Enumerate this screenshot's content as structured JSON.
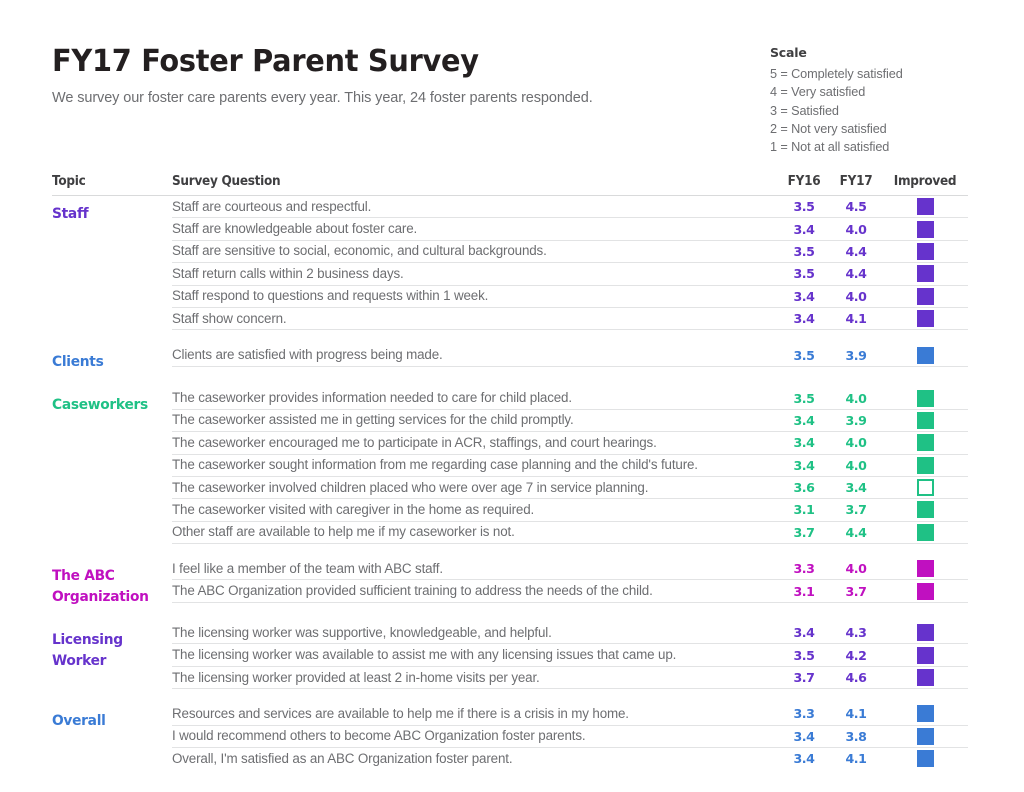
{
  "header": {
    "title": "FY17 Foster Parent Survey",
    "subtitle": "We survey our foster care parents every year. This year, 24 foster parents responded."
  },
  "scale": {
    "title": "Scale",
    "items": [
      "5 = Completely satisfied",
      "4 = Very satisfied",
      "3 = Satisfied",
      "2 = Not very satisfied",
      "1 = Not at all satisfied"
    ]
  },
  "table": {
    "columns": {
      "topic": "Topic",
      "question": "Survey Question",
      "fy16": "FY16",
      "fy17": "FY17",
      "improved": "Improved"
    },
    "colors": {
      "staff": "#6633cc",
      "clients": "#3a7bd5",
      "caseworkers": "#1fc185",
      "abc": "#c010c0",
      "licensing": "#6633cc",
      "overall": "#3a7bd5"
    },
    "sections": [
      {
        "topic": "Staff",
        "color": "#6633cc",
        "rows": [
          {
            "question": "Staff are courteous and respectful.",
            "fy16": "3.5",
            "fy17": "4.5",
            "improved": true
          },
          {
            "question": "Staff are knowledgeable about foster care.",
            "fy16": "3.4",
            "fy17": "4.0",
            "improved": true
          },
          {
            "question": "Staff are sensitive to social, economic, and cultural backgrounds.",
            "fy16": "3.5",
            "fy17": "4.4",
            "improved": true
          },
          {
            "question": "Staff return calls within 2 business days.",
            "fy16": "3.5",
            "fy17": "4.4",
            "improved": true
          },
          {
            "question": "Staff respond to questions and requests within 1 week.",
            "fy16": "3.4",
            "fy17": "4.0",
            "improved": true
          },
          {
            "question": "Staff show concern.",
            "fy16": "3.4",
            "fy17": "4.1",
            "improved": true
          }
        ]
      },
      {
        "topic": "Clients",
        "color": "#3a7bd5",
        "rows": [
          {
            "question": "Clients are satisfied with progress being made.",
            "fy16": "3.5",
            "fy17": "3.9",
            "improved": true
          }
        ]
      },
      {
        "topic": "Caseworkers",
        "color": "#1fc185",
        "rows": [
          {
            "question": "The caseworker provides information needed to care for child placed.",
            "fy16": "3.5",
            "fy17": "4.0",
            "improved": true
          },
          {
            "question": "The caseworker assisted me in getting services for the child promptly.",
            "fy16": "3.4",
            "fy17": "3.9",
            "improved": true
          },
          {
            "question": "The caseworker encouraged me to participate in ACR, staffings, and court hearings.",
            "fy16": "3.4",
            "fy17": "4.0",
            "improved": true
          },
          {
            "question": "The caseworker sought information from me regarding case planning and the child's future.",
            "fy16": "3.4",
            "fy17": "4.0",
            "improved": true
          },
          {
            "question": "The caseworker involved children placed who were over age 7 in service planning.",
            "fy16": "3.6",
            "fy17": "3.4",
            "improved": false
          },
          {
            "question": "The caseworker visited with caregiver in the home as required.",
            "fy16": "3.1",
            "fy17": "3.7",
            "improved": true
          },
          {
            "question": "Other staff are available to help me if my caseworker is not.",
            "fy16": "3.7",
            "fy17": "4.4",
            "improved": true
          }
        ]
      },
      {
        "topic": "The ABC Organization",
        "color": "#c010c0",
        "rows": [
          {
            "question": "I feel like a member of the team with ABC staff.",
            "fy16": "3.3",
            "fy17": "4.0",
            "improved": true
          },
          {
            "question": "The ABC Organization provided sufficient training to address the needs of the child.",
            "fy16": "3.1",
            "fy17": "3.7",
            "improved": true
          }
        ]
      },
      {
        "topic": "Licensing Worker",
        "color": "#6633cc",
        "rows": [
          {
            "question": "The licensing worker was supportive, knowledgeable, and helpful.",
            "fy16": "3.4",
            "fy17": "4.3",
            "improved": true
          },
          {
            "question": "The licensing worker was available to assist me with any licensing issues that came up.",
            "fy16": "3.5",
            "fy17": "4.2",
            "improved": true
          },
          {
            "question": "The licensing worker provided at least 2 in-home visits per year.",
            "fy16": "3.7",
            "fy17": "4.6",
            "improved": true
          }
        ]
      },
      {
        "topic": "Overall",
        "color": "#3a7bd5",
        "rows": [
          {
            "question": "Resources and services are available to help me if there is a crisis in my home.",
            "fy16": "3.3",
            "fy17": "4.1",
            "improved": true
          },
          {
            "question": "I would recommend others to become ABC Organization foster parents.",
            "fy16": "3.4",
            "fy17": "3.8",
            "improved": true
          },
          {
            "question": "Overall, I'm satisfied as an ABC Organization foster parent.",
            "fy16": "3.4",
            "fy17": "4.1",
            "improved": true
          }
        ]
      }
    ]
  }
}
